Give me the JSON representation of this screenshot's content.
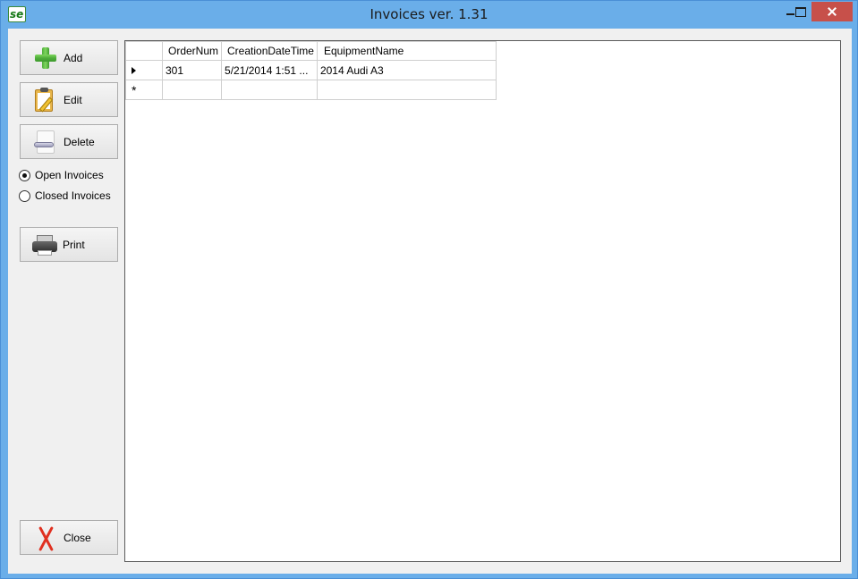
{
  "window": {
    "app_icon_text": "se",
    "title": "Invoices ver. 1.31"
  },
  "toolbar": {
    "add_label": "Add",
    "edit_label": "Edit",
    "delete_label": "Delete",
    "print_label": "Print",
    "close_label": "Close"
  },
  "filter": {
    "open_label": "Open Invoices",
    "closed_label": "Closed Invoices",
    "selected": "open"
  },
  "grid": {
    "columns": [
      "OrderNum",
      "CreationDateTime",
      "EquipmentName"
    ],
    "rows": [
      {
        "order_num": "301",
        "creation": "5/21/2014 1:51 ...",
        "equipment": "2014 Audi A3"
      }
    ],
    "new_row_marker": "*"
  },
  "colors": {
    "title_bar": "#6aaee9",
    "close_button": "#c7504a",
    "client_bg": "#f0f0f0"
  }
}
